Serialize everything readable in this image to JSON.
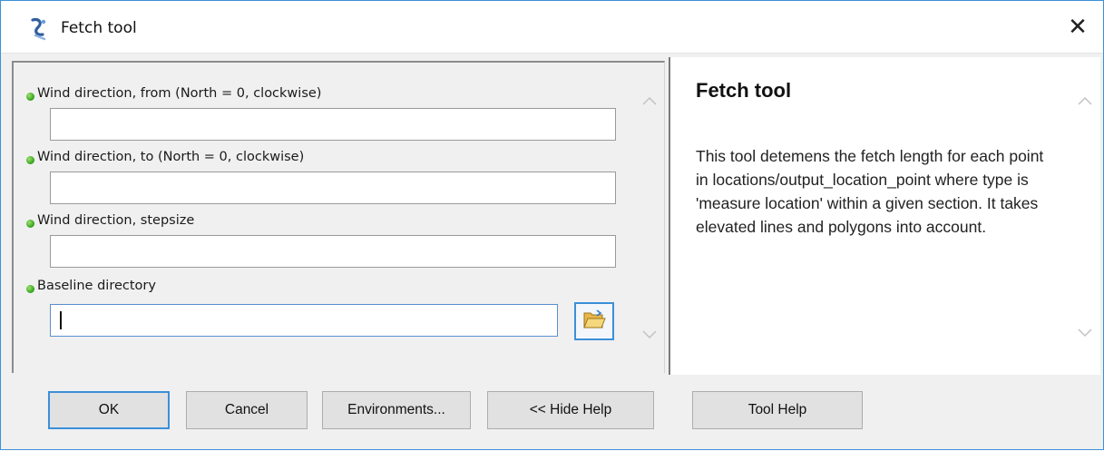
{
  "window": {
    "title": "Fetch tool",
    "close_glyph": "✕"
  },
  "parameters": [
    {
      "label": "Wind direction, from (North = 0, clockwise)",
      "value": "",
      "required": true
    },
    {
      "label": "Wind direction, to (North = 0, clockwise)",
      "value": "",
      "required": true
    },
    {
      "label": "Wind direction, stepsize",
      "value": "",
      "required": true
    },
    {
      "label": "Baseline directory",
      "value": "",
      "required": true,
      "focused": true
    }
  ],
  "help": {
    "title": "Fetch tool",
    "body": "This tool detemens the fetch length for each point in locations/output_location_point where type is 'measure location' within a given section. It takes elevated lines and polygons into account."
  },
  "buttons": {
    "ok": "OK",
    "cancel": "Cancel",
    "environments": "Environments...",
    "hide_help": "<< Hide Help",
    "tool_help": "Tool Help"
  },
  "colors": {
    "accent": "#3c8fd8",
    "required_bullet": "#2f9e1c",
    "dialog_bg": "#f0f0f0"
  },
  "icons": [
    "tool-script-icon",
    "close-icon",
    "folder-open-icon",
    "chevron-up-icon",
    "chevron-down-icon"
  ]
}
